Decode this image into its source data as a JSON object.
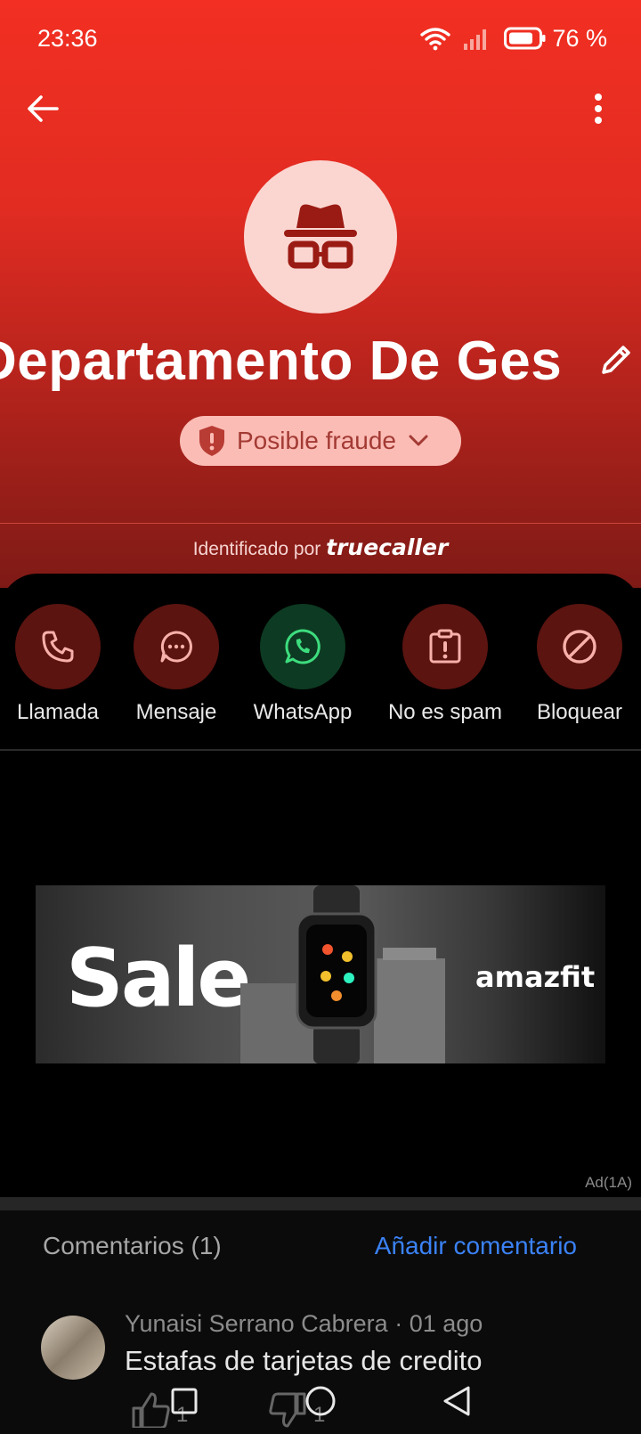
{
  "status": {
    "time": "23:36",
    "battery": "76 %"
  },
  "contact": {
    "name": "Departamento De Ges",
    "badge_label": "Posible fraude",
    "identified_prefix": "Identificado por",
    "identified_brand": "truecaller"
  },
  "actions": [
    {
      "label": "Llamada",
      "icon": "phone-icon"
    },
    {
      "label": "Mensaje",
      "icon": "message-icon"
    },
    {
      "label": "WhatsApp",
      "icon": "whatsapp-icon"
    },
    {
      "label": "No es spam",
      "icon": "not-spam-icon"
    },
    {
      "label": "Bloquear",
      "icon": "block-icon"
    }
  ],
  "ad": {
    "headline": "Sale",
    "brand": "amazfit",
    "ad_label": "Ad(1A)"
  },
  "comments": {
    "title": "Comentarios (1)",
    "add_label": "Añadir comentario",
    "items": [
      {
        "author": "Yunaisi Serrano Cabrera",
        "date": "01 ago",
        "text": "Estafas de tarjetas de credito",
        "likes": "1",
        "dislikes": "1"
      }
    ]
  },
  "colors": {
    "header_top": "#f22f22",
    "accent_link": "#3b82f6",
    "badge_bg": "#fbbcb5",
    "action_circle": "#5b1410",
    "whatsapp_circle": "#0d3a22"
  }
}
